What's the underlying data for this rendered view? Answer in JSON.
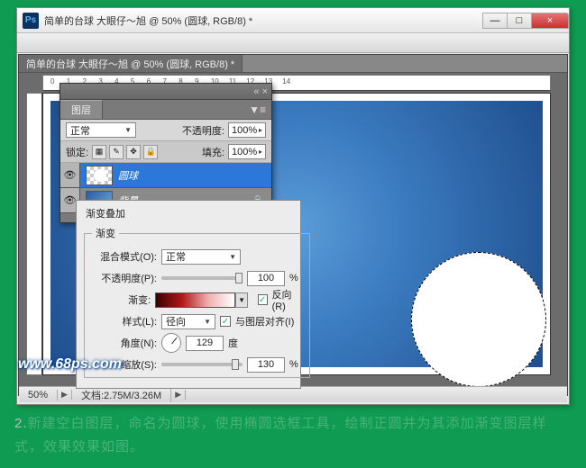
{
  "window": {
    "title": "简单的台球   大眼仔～旭 @ 50% (圆球, RGB/8) *",
    "min": "—",
    "max": "□",
    "close": "×"
  },
  "layers_panel": {
    "tab": "图层",
    "blend_label": "正常",
    "opacity_label": "不透明度:",
    "opacity_value": "100%",
    "lock_label": "锁定:",
    "fill_label": "填充:",
    "fill_value": "100%",
    "layers": [
      {
        "name": "圆球",
        "lock": ""
      },
      {
        "name": "背景",
        "lock": "🔒"
      }
    ]
  },
  "overlay": {
    "section": "渐变叠加",
    "subsection": "渐变",
    "blend_label": "混合模式(O):",
    "blend_value": "正常",
    "opacity_label": "不透明度(P):",
    "opacity_value": "100",
    "pct": "%",
    "gradient_label": "渐变:",
    "reverse_label": "反向(R)",
    "style_label": "样式(L):",
    "style_value": "径向",
    "align_label": "与图层对齐(I)",
    "angle_label": "角度(N):",
    "angle_value": "129",
    "angle_unit": "度",
    "scale_label": "缩放(S):",
    "scale_value": "130",
    "checked": "✓"
  },
  "status": {
    "zoom": "50%",
    "doc": "文档:2.75M/3.26M"
  },
  "watermark": "www.68ps.com",
  "caption": {
    "num": "2.",
    "text": "新建空白图层，命名为圆球，使用椭圆选框工具，绘制正圆并为其添加渐变图层样式，效果效果如图。"
  }
}
